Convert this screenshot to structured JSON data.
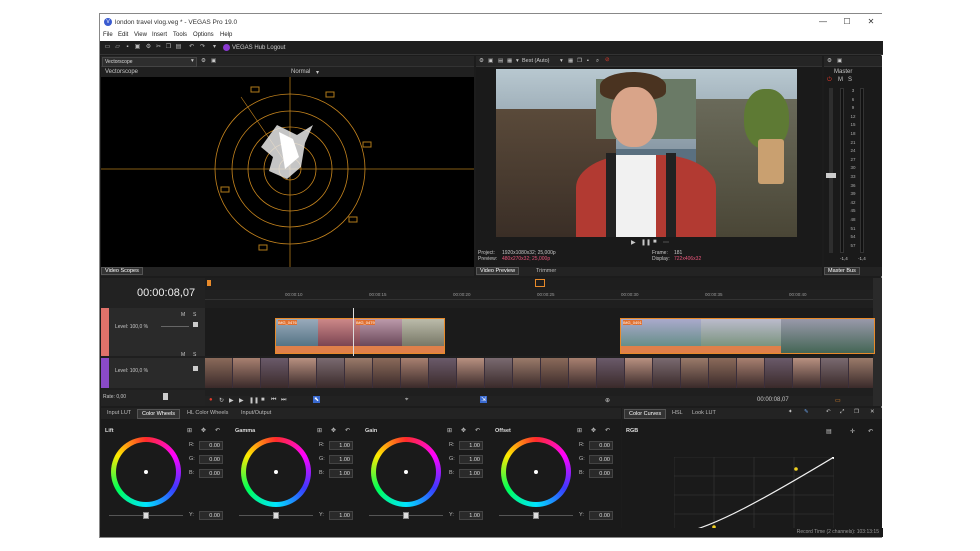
{
  "window": {
    "title": "london travel vlog.veg * - VEGAS Pro 19.0",
    "app_icon": "vegas-logo-icon",
    "min": "—",
    "max": "☐",
    "close": "✕"
  },
  "menu": [
    "File",
    "Edit",
    "View",
    "Insert",
    "Tools",
    "Options",
    "Help"
  ],
  "toolbar": {
    "hub_label": "VEGAS Hub Logout"
  },
  "scope": {
    "selector": "Vectorscope",
    "sub_label": "Vectorscope",
    "mode": "Normal",
    "tab": "Video Scopes"
  },
  "preview": {
    "quality": "Best (Auto)",
    "project": "Project:",
    "project_val": "1920x1080x32; 25,000p",
    "preview": "Preview:",
    "preview_val": "480x270x32; 25,000p",
    "frame": "Frame:",
    "frame_val": "181",
    "display": "Display:",
    "display_val": "722x406x32",
    "tab": "Video Preview",
    "tab2": "Trimmer"
  },
  "master": {
    "label": "Master",
    "m": "M",
    "s": "S",
    "scale": [
      "3",
      "6",
      "9",
      "12",
      "15",
      "18",
      "21",
      "24",
      "27",
      "30",
      "33",
      "36",
      "39",
      "42",
      "45",
      "48",
      "51",
      "54",
      "57"
    ],
    "left_val": "-1,4",
    "right_val": "-1,4",
    "tab": "Master Bus"
  },
  "timeline": {
    "timecode": "00:00:08,07",
    "ticks": [
      "00:00:10",
      "00:00:15",
      "00:00:20",
      "00:00:25",
      "00:00:30",
      "00:00:35",
      "00:00:40"
    ],
    "track1_level": "Level: 100,0 %",
    "track2_level": "Level: 100,0 %",
    "rate": "Rate: 0,00",
    "end_time": "00:00:08,07",
    "clip_labels": [
      "IMG_0476",
      "IMG_0479",
      "IMG_0491",
      "IMG_0476",
      "IMG_0479",
      "IMG_0491"
    ]
  },
  "grading_tabs": [
    "Input LUT",
    "Color Wheels",
    "HL Color Wheels",
    "Input/Output"
  ],
  "grading_active": "Color Wheels",
  "wheels": [
    {
      "name": "Lift",
      "r": "0.00",
      "g": "0.00",
      "b": "0.00",
      "y": "0.00"
    },
    {
      "name": "Gamma",
      "r": "1.00",
      "g": "1.00",
      "b": "1.00",
      "y": "1.00"
    },
    {
      "name": "Gain",
      "r": "1.00",
      "g": "1.00",
      "b": "1.00",
      "y": "1.00"
    },
    {
      "name": "Offset",
      "r": "0.00",
      "g": "0.00",
      "b": "0.00",
      "y": "0.00"
    }
  ],
  "rgb": {
    "r": "R:",
    "g": "G:",
    "b": "B:",
    "y": "Y:"
  },
  "curves_tabs": [
    "Color Curves",
    "HSL",
    "Look LUT"
  ],
  "curves_active": "Color Curves",
  "curves": {
    "channel": "RGB"
  },
  "status": {
    "record": "Record Time (2 channels): 103:13:15"
  }
}
